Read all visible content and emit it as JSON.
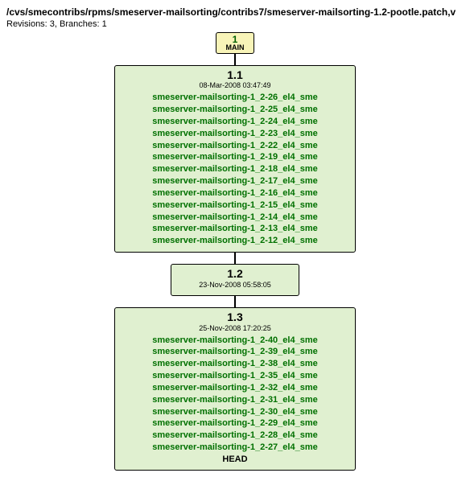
{
  "header": {
    "path": "/cvs/smecontribs/rpms/smeserver-mailsorting/contribs7/smeserver-mailsorting-1.2-pootle.patch,v",
    "meta": "Revisions: 3, Branches: 1"
  },
  "branch": {
    "num": "1",
    "name": "MAIN"
  },
  "rev11": {
    "version": "1.1",
    "date": "08-Mar-2008 03:47:49",
    "tags": [
      "smeserver-mailsorting-1_2-26_el4_sme",
      "smeserver-mailsorting-1_2-25_el4_sme",
      "smeserver-mailsorting-1_2-24_el4_sme",
      "smeserver-mailsorting-1_2-23_el4_sme",
      "smeserver-mailsorting-1_2-22_el4_sme",
      "smeserver-mailsorting-1_2-19_el4_sme",
      "smeserver-mailsorting-1_2-18_el4_sme",
      "smeserver-mailsorting-1_2-17_el4_sme",
      "smeserver-mailsorting-1_2-16_el4_sme",
      "smeserver-mailsorting-1_2-15_el4_sme",
      "smeserver-mailsorting-1_2-14_el4_sme",
      "smeserver-mailsorting-1_2-13_el4_sme",
      "smeserver-mailsorting-1_2-12_el4_sme"
    ]
  },
  "rev12": {
    "version": "1.2",
    "date": "23-Nov-2008 05:58:05"
  },
  "rev13": {
    "version": "1.3",
    "date": "25-Nov-2008 17:20:25",
    "tags": [
      "smeserver-mailsorting-1_2-40_el4_sme",
      "smeserver-mailsorting-1_2-39_el4_sme",
      "smeserver-mailsorting-1_2-38_el4_sme",
      "smeserver-mailsorting-1_2-35_el4_sme",
      "smeserver-mailsorting-1_2-32_el4_sme",
      "smeserver-mailsorting-1_2-31_el4_sme",
      "smeserver-mailsorting-1_2-30_el4_sme",
      "smeserver-mailsorting-1_2-29_el4_sme",
      "smeserver-mailsorting-1_2-28_el4_sme",
      "smeserver-mailsorting-1_2-27_el4_sme"
    ],
    "head": "HEAD"
  }
}
